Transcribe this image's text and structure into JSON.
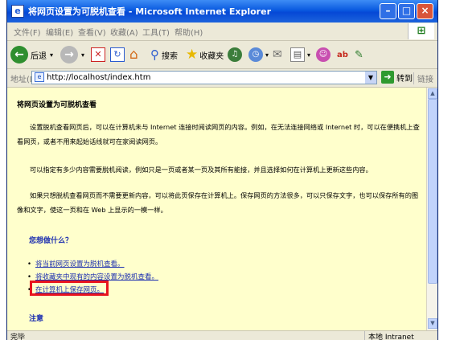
{
  "window": {
    "title": "将网页设置为可脱机查看 - Microsoft Internet Explorer",
    "app_icon": "e"
  },
  "menu": [
    "文件(F)",
    "编辑(E)",
    "查看(V)",
    "收藏(A)",
    "工具(T)",
    "帮助(H)"
  ],
  "toolbar": {
    "back_label": "后退",
    "search_label": "搜索",
    "favorites_label": "收藏夹"
  },
  "address": {
    "label": "地址(D)",
    "url": "http://localhost/index.htm",
    "go_label": "转到",
    "links_label": "链接"
  },
  "page": {
    "title": "将网页设置为可脱机查看",
    "paragraphs": [
      "设置脱机查看网页后，可以在计算机未与 Internet 连接时阅读网页的内容。例如，在无法连接网络或 Internet 时，可以在便携机上查看网页，或者不用来起始话线就可在家阅读网页。",
      "可以指定有多少内容需要脱机阅读，例如只是一页或者某一页及其所有能接，并且选择如何在计算机上更新这些内容。",
      "如果只想脱机查看网页而不需要更新内容，可以将此页保存在计算机上。保存网页的方法很多，可以只保存文字，也可以保存所有的图像和文字，使这一页和在 Web 上显示的一模一样。"
    ],
    "question": "您想做什么？",
    "actions": [
      "将当前网页设置为脱机查看。",
      "将收藏夹中现有的内容设置为脱机查看。",
      "在计算机上保存网页。"
    ],
    "note_heading": "注意"
  },
  "status": {
    "left": "完毕",
    "zone": "本地 Intranet"
  },
  "colors": {
    "page_background": "#ffffcc",
    "link": "#1d2fb0",
    "highlight_box": "#e8141e"
  }
}
